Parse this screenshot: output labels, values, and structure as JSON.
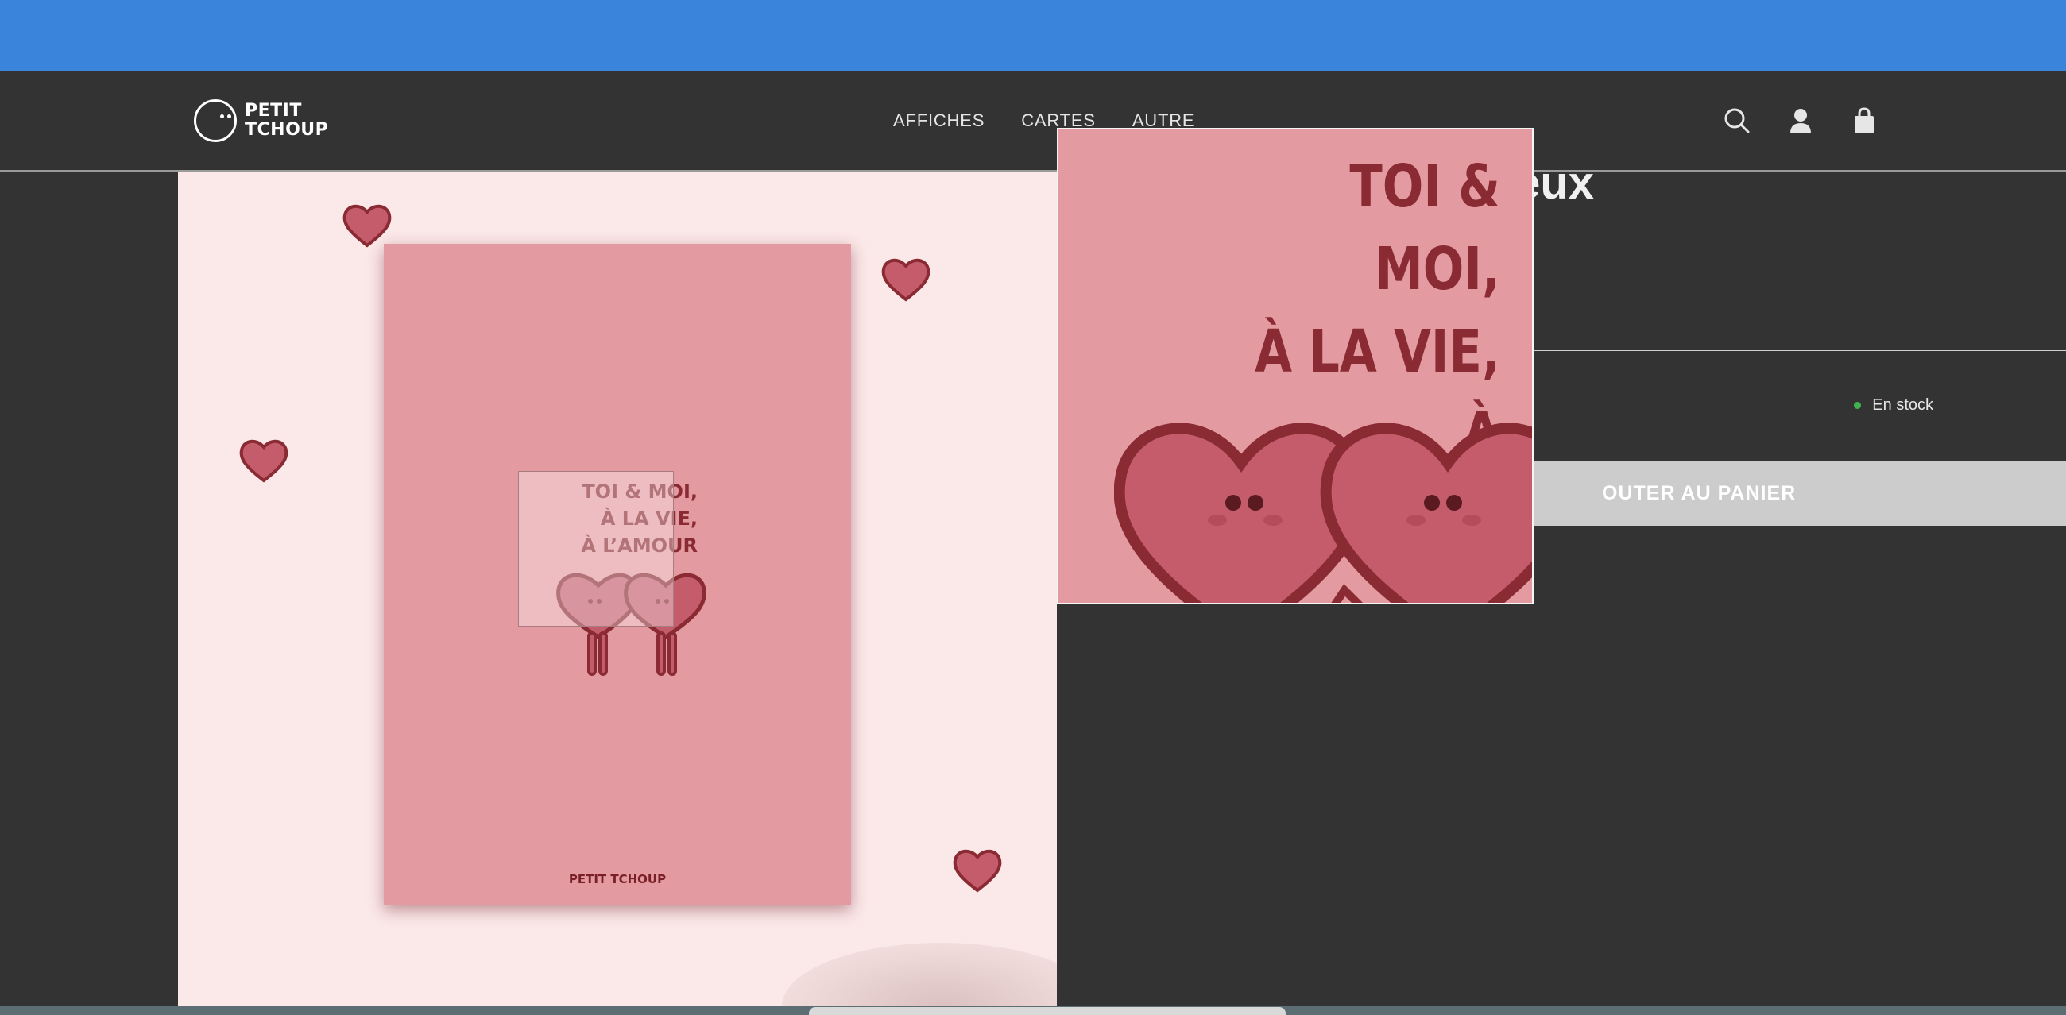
{
  "brand": {
    "name_line1": "PETIT",
    "name_line2": "TCHOUP",
    "logo_icon": "face-circle-logo"
  },
  "nav": {
    "items": [
      {
        "label": "AFFICHES"
      },
      {
        "label": "CARTES"
      },
      {
        "label": "AUTRE"
      }
    ]
  },
  "header_icons": [
    "search-icon",
    "account-icon",
    "cart-icon"
  ],
  "product": {
    "title_fragment": "ieux",
    "stock_label": "En stock",
    "add_to_cart_label": "OUTER AU PANIER",
    "poster_brand": "PETIT TCHOUP",
    "poster_text_lines": [
      "TOI & MOI,",
      "À LA VIE,",
      "À L’AMOUR"
    ]
  },
  "zoom": {
    "lines": [
      "TOI & MOI,",
      "À LA VIE,",
      "À L’AMOUR"
    ]
  },
  "colors": {
    "announcement": "#3a84dc",
    "header": "#333333",
    "poster": "#e39aa0",
    "heart": "#c45c6c",
    "outline": "#8a2a32",
    "stock": "#3fb24f"
  }
}
